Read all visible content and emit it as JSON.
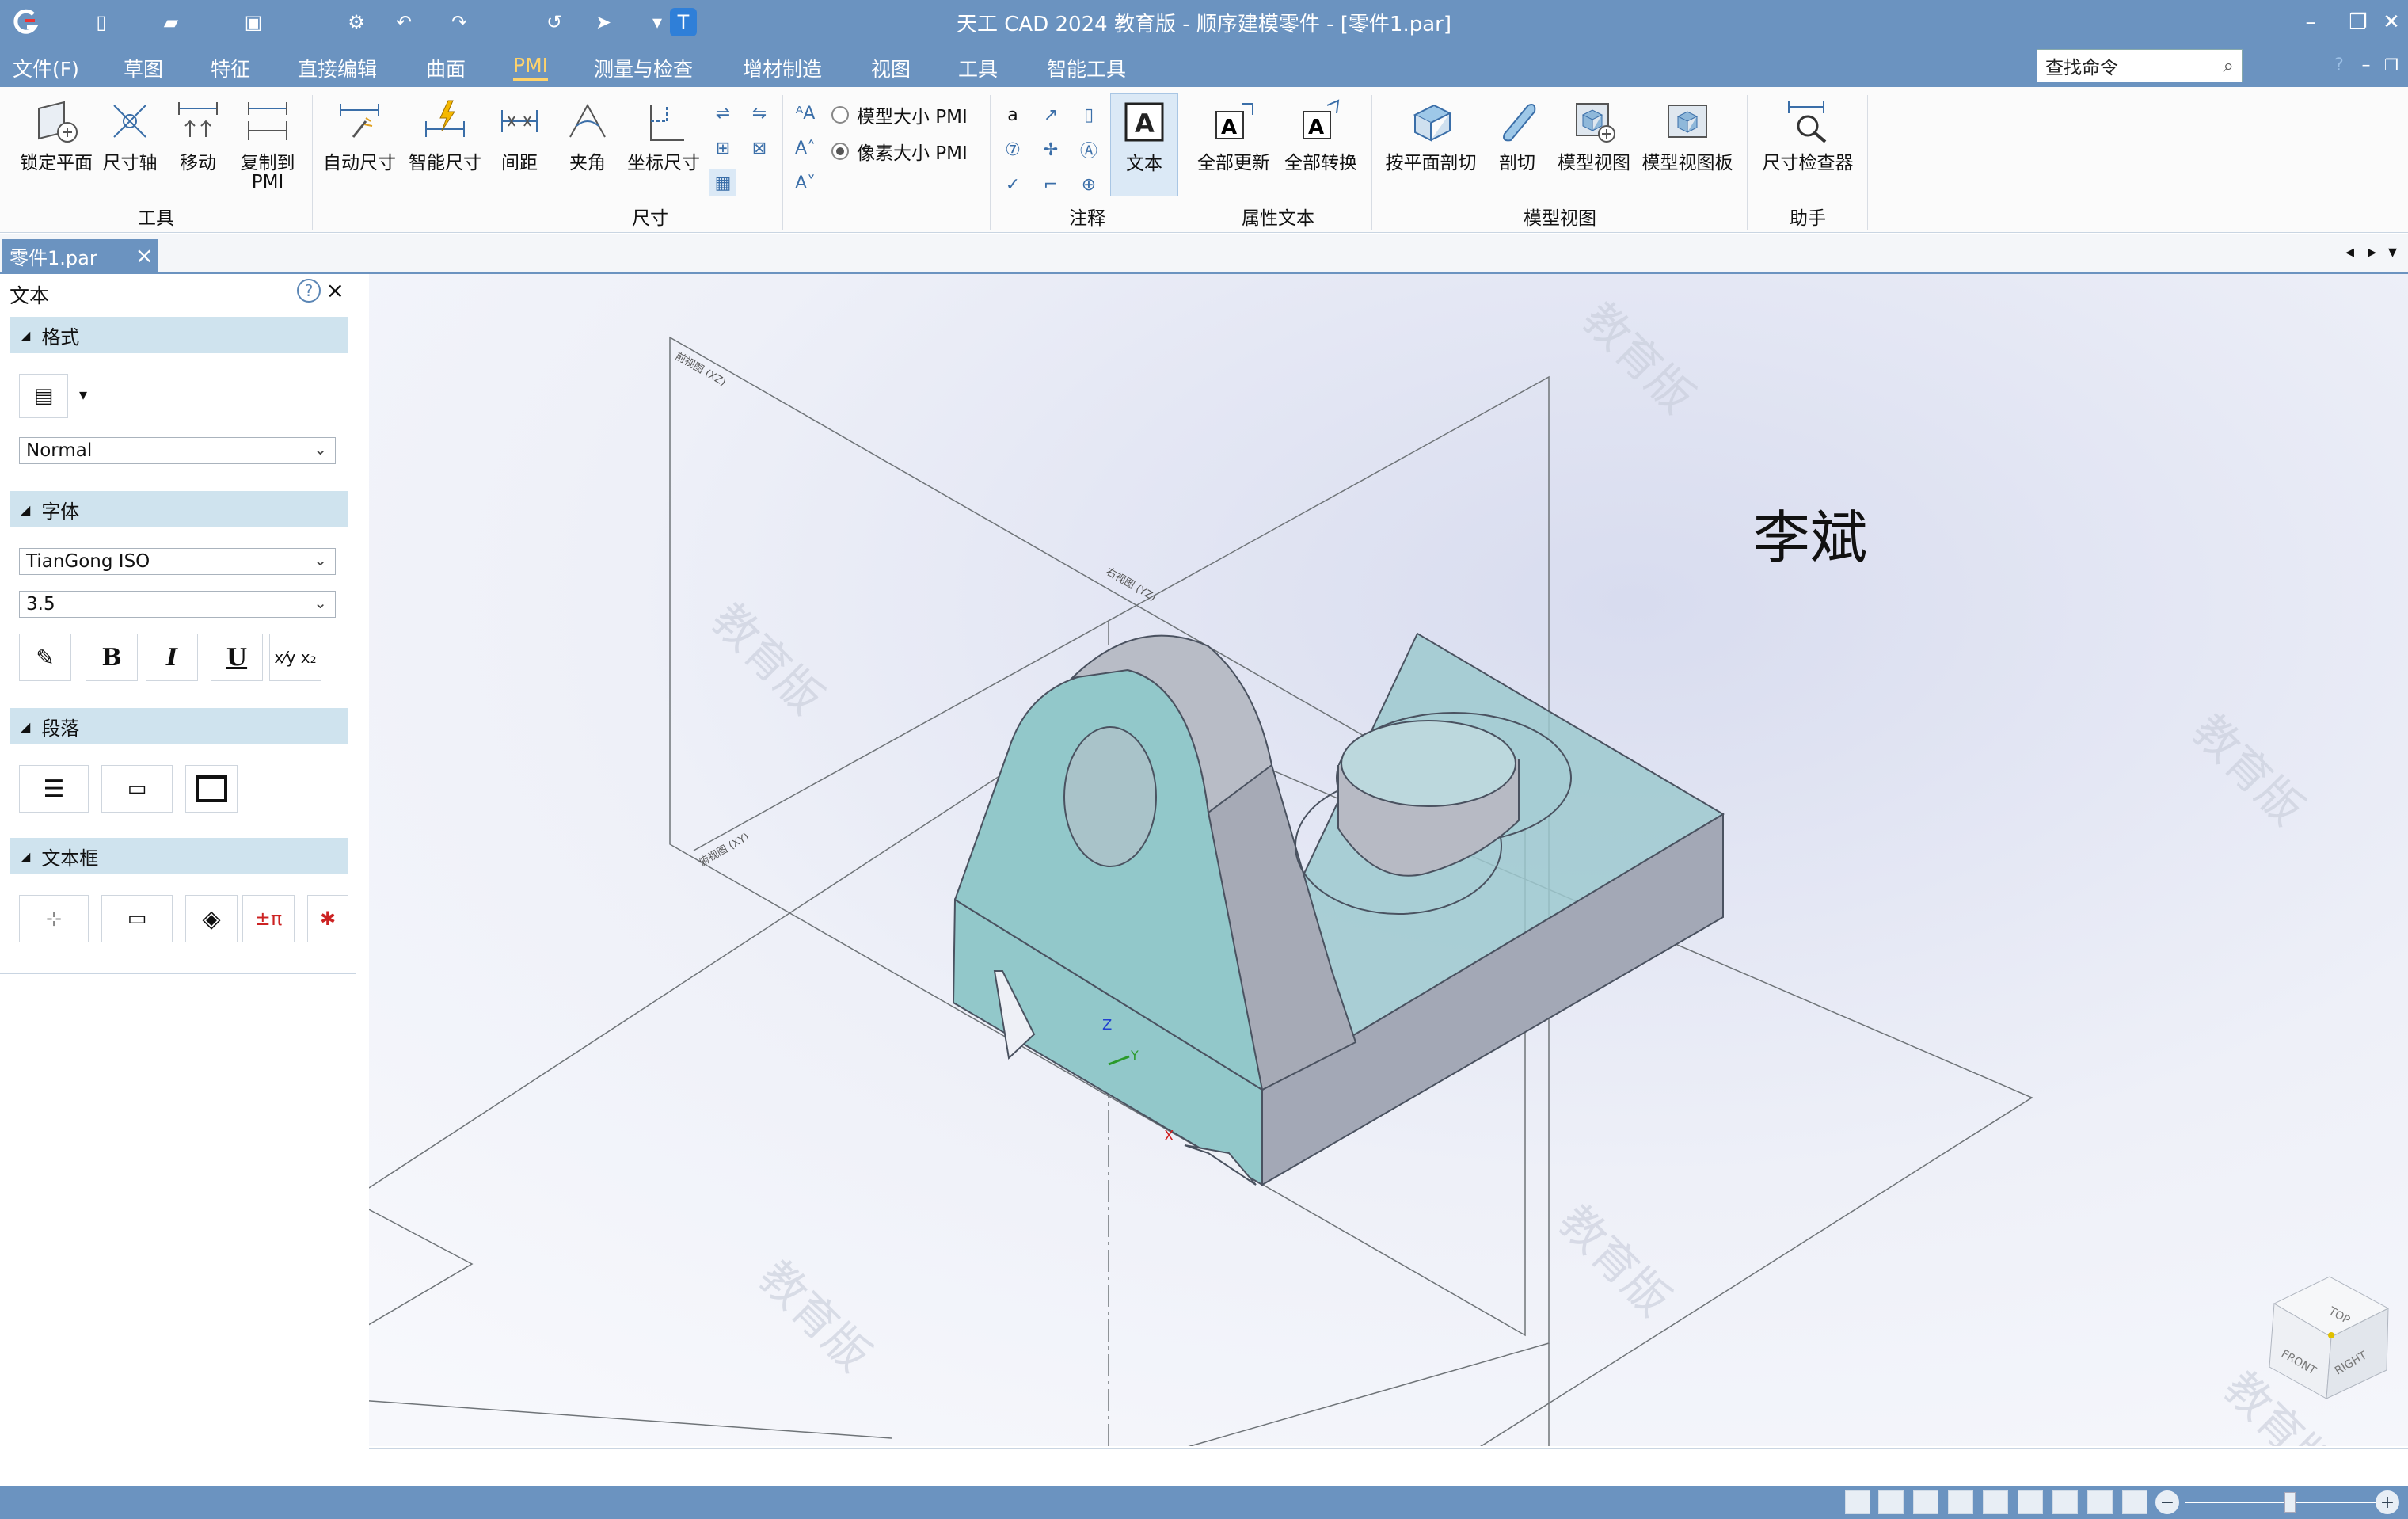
{
  "app": {
    "title": "天工 CAD 2024 教育版 - 顺序建模零件 - [零件1.par]"
  },
  "menu": {
    "items": [
      "文件(F)",
      "草图",
      "特征",
      "直接编辑",
      "曲面",
      "PMI",
      "测量与检查",
      "增材制造",
      "视图",
      "工具",
      "智能工具"
    ],
    "active": "PMI"
  },
  "search": {
    "placeholder": "查找命令",
    "icon": "search-icon"
  },
  "ribbon": {
    "tools": [
      "锁定平面",
      "尺寸轴",
      "移动",
      "复制到\nPMI"
    ],
    "dims": [
      "自动尺寸",
      "智能尺寸",
      "间距",
      "夹角",
      "坐标尺寸"
    ],
    "radio_model": "模型大小 PMI",
    "radio_pixel": "像素大小 PMI",
    "annot_text": "文本",
    "attr": [
      "全部更新",
      "全部转换"
    ],
    "views": [
      "按平面剖切",
      "剖切",
      "模型视图",
      "模型视图板"
    ],
    "helper": [
      "尺寸检查器"
    ],
    "groups": {
      "tools": "工具",
      "dims": "尺寸",
      "annot": "注释",
      "attr": "属性文本",
      "views": "模型视图",
      "helper": "助手"
    }
  },
  "doc_tab": {
    "label": "零件1.par"
  },
  "panel": {
    "title": "文本",
    "sections": {
      "format": "格式",
      "font": "字体",
      "paragraph": "段落",
      "textbox": "文本框"
    },
    "style_value": "Normal",
    "font_value": "TianGong ISO",
    "size_value": "3.5",
    "bold": "B",
    "italic": "I",
    "underline": "U"
  },
  "viewport": {
    "annotation_text": "李斌",
    "view_cube": {
      "top": "TOP",
      "front": "FRONT",
      "right": "RIGHT"
    },
    "axis": {
      "z": "Z",
      "y": "Y",
      "x": "X"
    },
    "plane_labels": [
      "前视图 (XZ)",
      "俯视图 (XY)",
      "右视图 (YZ)"
    ],
    "watermark": "教育版"
  },
  "colors": {
    "titlebar": "#6b93c0",
    "active_menu": "#ffd36b",
    "part_teal": "#8dc5c8",
    "part_gray": "#a9aebb"
  }
}
